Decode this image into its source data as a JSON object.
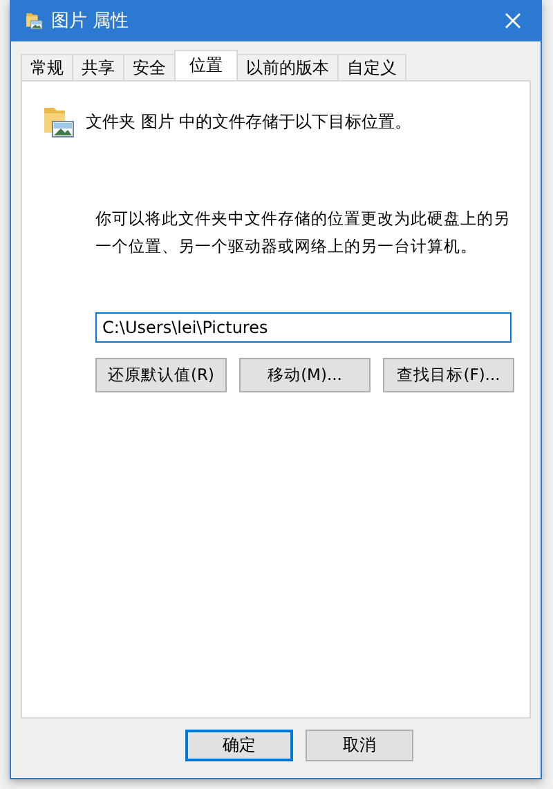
{
  "window": {
    "title": "图片 属性"
  },
  "tabs": [
    {
      "label": "常规",
      "selected": false
    },
    {
      "label": "共享",
      "selected": false
    },
    {
      "label": "安全",
      "selected": false
    },
    {
      "label": "位置",
      "selected": true
    },
    {
      "label": "以前的版本",
      "selected": false
    },
    {
      "label": "自定义",
      "selected": false
    }
  ],
  "location": {
    "heading": "文件夹 图片 中的文件存储于以下目标位置。",
    "description": "你可以将此文件夹中文件存储的位置更改为此硬盘上的另一个位置、另一个驱动器或网络上的另一台计算机。",
    "path": "C:\\Users\\lei\\Pictures",
    "buttons": [
      "还原默认值(R)",
      "移动(M)...",
      "查找目标(F)..."
    ]
  },
  "dialog_buttons": [
    {
      "label": "确定",
      "selected": true
    },
    {
      "label": "取消",
      "selected": false
    }
  ]
}
